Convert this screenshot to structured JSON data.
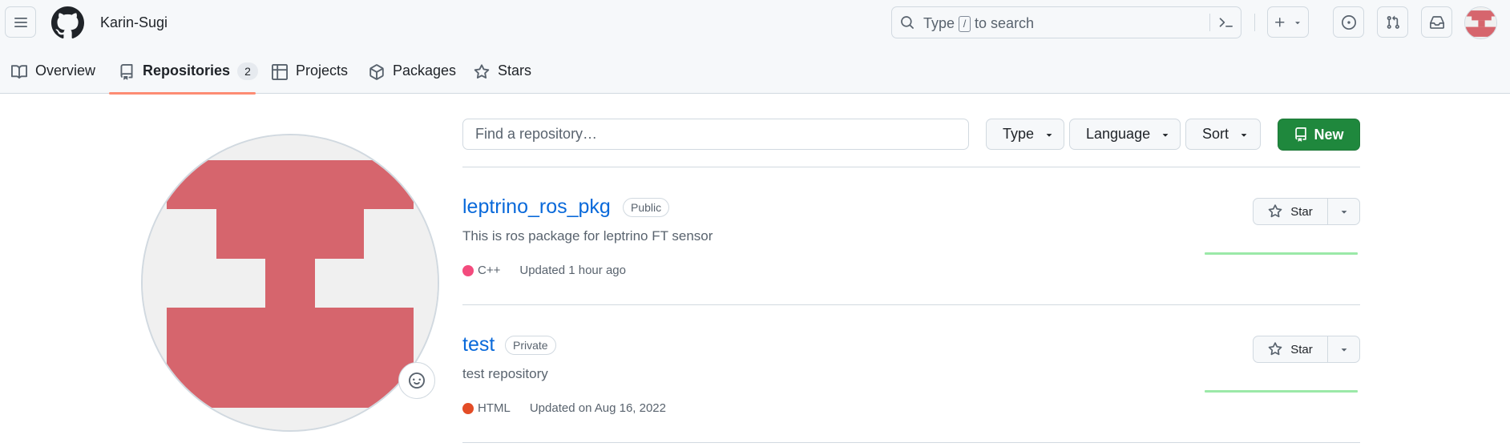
{
  "header": {
    "owner_name": "Karin-Sugi",
    "search": {
      "prefix": "Type",
      "key": "/",
      "suffix": "to search"
    }
  },
  "tabs": [
    {
      "label": "Overview",
      "icon": "book-icon"
    },
    {
      "label": "Repositories",
      "icon": "repo-icon",
      "counter": "2",
      "active": true
    },
    {
      "label": "Projects",
      "icon": "table-icon"
    },
    {
      "label": "Packages",
      "icon": "package-icon"
    },
    {
      "label": "Stars",
      "icon": "star-icon"
    }
  ],
  "filters": {
    "find_placeholder": "Find a repository…",
    "type_label": "Type",
    "language_label": "Language",
    "sort_label": "Sort",
    "new_label": "New"
  },
  "repos": [
    {
      "name": "leptrino_ros_pkg",
      "visibility": "Public",
      "description": "This is ros package for leptrino FT sensor",
      "language": "C++",
      "language_color": "#f34b7d",
      "updated": "Updated 1 hour ago",
      "star_label": "Star"
    },
    {
      "name": "test",
      "visibility": "Private",
      "description": "test repository",
      "language": "HTML",
      "language_color": "#e34c26",
      "updated": "Updated on Aug 16, 2022",
      "star_label": "Star"
    }
  ],
  "colors": {
    "accent_tab": "#fd8c73",
    "new_button": "#1f883d",
    "link": "#0969da",
    "avatar": "#d6656d"
  }
}
